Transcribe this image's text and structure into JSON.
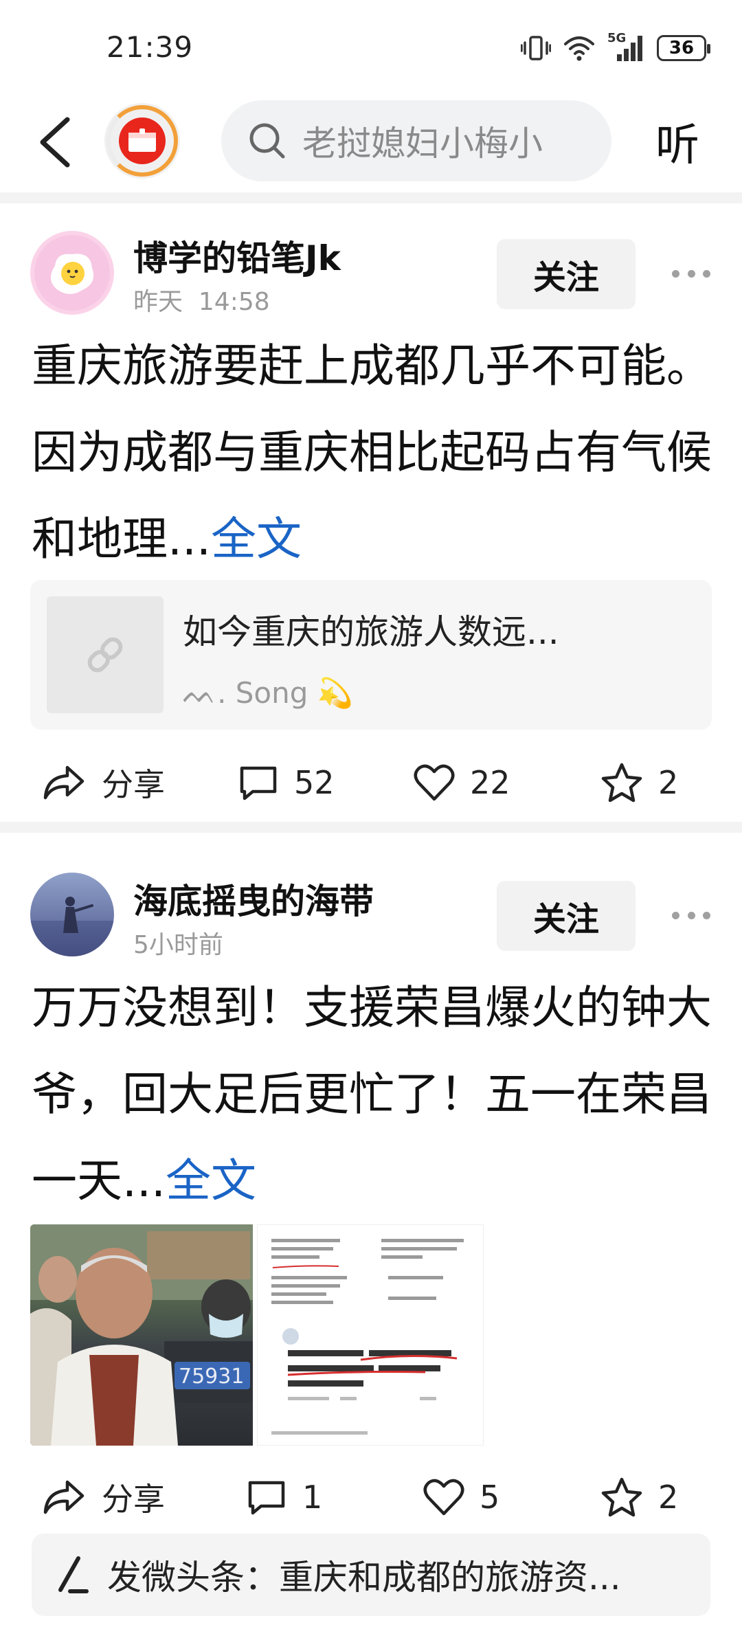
{
  "status": {
    "time": "21:39",
    "network": "5G",
    "battery": "36"
  },
  "nav": {
    "search_placeholder": "老挝媳妇小梅小",
    "listen_label": "听"
  },
  "posts": [
    {
      "author": "博学的铅笔Jk",
      "date": "昨天",
      "time": "14:58",
      "follow_label": "关注",
      "text": "重庆旅游要赶上成都几乎不可能。因为成都与重庆相比起码占有气候和地理...",
      "fulltext_label": "全文",
      "link": {
        "title": "如今重庆的旅游人数远...",
        "source": "ᨓ. Song 💫"
      },
      "actions": {
        "share": "分享",
        "comments": "52",
        "likes": "22",
        "favorites": "2"
      }
    },
    {
      "author": "海底摇曳的海带",
      "date": "5小时前",
      "follow_label": "关注",
      "text": "万万没想到！支援荣昌爆火的钟大爷，回大足后更忙了！五一在荣昌一天...",
      "fulltext_label": "全文",
      "actions": {
        "share": "分享",
        "comments": "1",
        "likes": "5",
        "favorites": "2"
      }
    }
  ],
  "bottom": {
    "label": "发微头条：重庆和成都的旅游资..."
  },
  "colors": {
    "link_blue": "#1a64c6",
    "logo_red": "#e8261c",
    "logo_orange": "#f2a03a"
  }
}
